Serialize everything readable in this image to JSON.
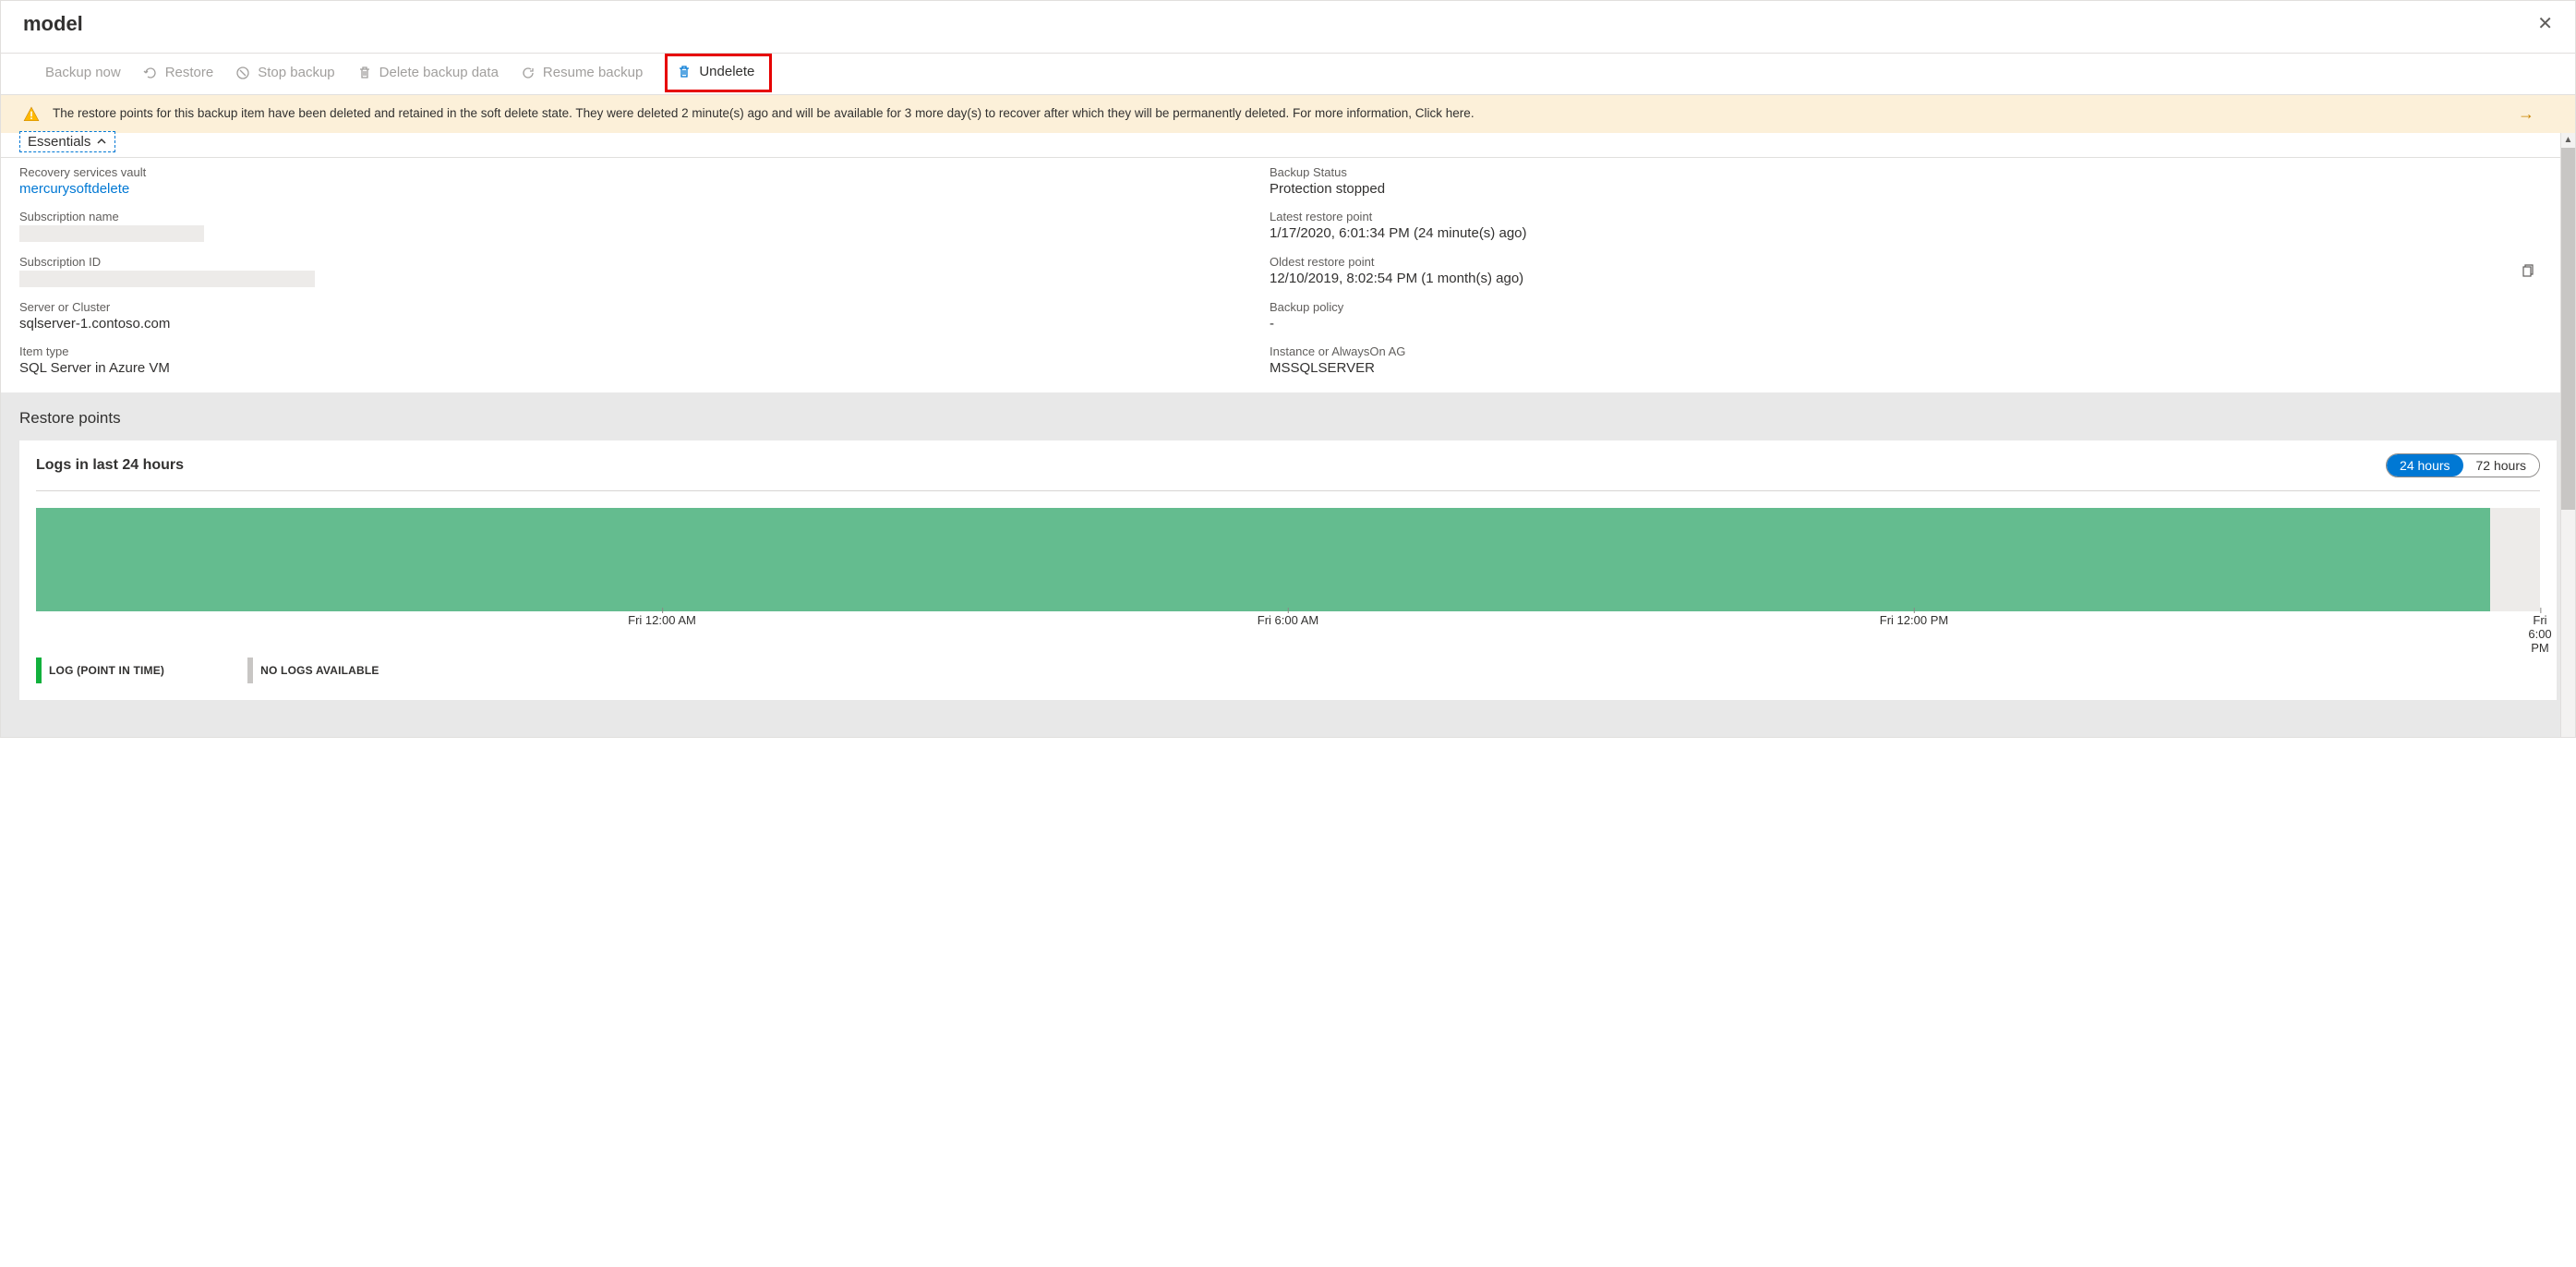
{
  "header": {
    "title": "model"
  },
  "toolbar": {
    "backup_now": "Backup now",
    "restore": "Restore",
    "stop_backup": "Stop backup",
    "delete_backup_data": "Delete backup data",
    "resume_backup": "Resume backup",
    "undelete": "Undelete"
  },
  "banner": {
    "message": "The restore points for this backup item have been deleted and retained in the soft delete state. They were deleted 2 minute(s) ago and will be available for 3 more day(s) to recover after which they will be permanently deleted. For more information, ",
    "link_text": "Click here."
  },
  "essentials": {
    "label": "Essentials",
    "left": {
      "recovery_vault_label": "Recovery services vault",
      "recovery_vault_value": "mercurysoftdelete",
      "subscription_name_label": "Subscription name",
      "subscription_id_label": "Subscription ID",
      "server_label": "Server or Cluster",
      "server_value": "sqlserver-1.contoso.com",
      "item_type_label": "Item type",
      "item_type_value": "SQL Server in Azure VM"
    },
    "right": {
      "backup_status_label": "Backup Status",
      "backup_status_value": "Protection stopped",
      "latest_rp_label": "Latest restore point",
      "latest_rp_value": "1/17/2020, 6:01:34 PM (24 minute(s) ago)",
      "oldest_rp_label": "Oldest restore point",
      "oldest_rp_value": "12/10/2019, 8:02:54 PM (1 month(s) ago)",
      "backup_policy_label": "Backup policy",
      "backup_policy_value": "-",
      "instance_label": "Instance or AlwaysOn AG",
      "instance_value": "MSSQLSERVER"
    }
  },
  "restore": {
    "title": "Restore points",
    "chart_title": "Logs in last 24 hours",
    "range_options": {
      "h24": "24 hours",
      "h72": "72 hours"
    },
    "legend": {
      "log": "LOG (POINT IN TIME)",
      "none": "NO LOGS AVAILABLE"
    }
  },
  "chart_data": {
    "type": "bar",
    "title": "Logs in last 24 hours",
    "categories": [
      "Fri 12:00 AM",
      "Fri 6:00 AM",
      "Fri 12:00 PM",
      "Fri 6:00 PM"
    ],
    "series": [
      {
        "name": "LOG (POINT IN TIME)",
        "coverage_percent": 98,
        "color": "#64bc8f"
      },
      {
        "name": "NO LOGS AVAILABLE",
        "coverage_percent": 2,
        "color": "#edebe9"
      }
    ],
    "xlabel": "",
    "ylabel": "",
    "ylim": null,
    "tick_positions_percent": [
      25,
      50,
      75,
      100
    ]
  }
}
